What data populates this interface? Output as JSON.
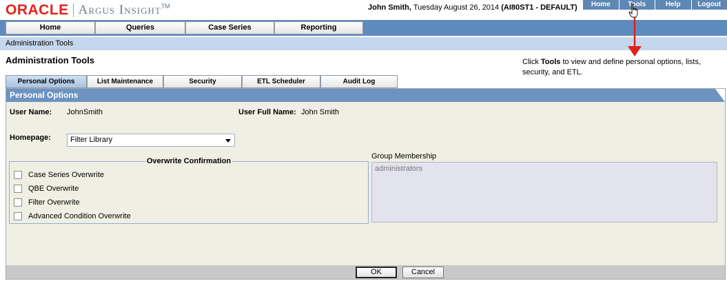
{
  "brand": {
    "oracle": "ORACLE",
    "product": "Argus Insight",
    "tm": "TM"
  },
  "user": {
    "name": "John Smith,",
    "date": "Tuesday August 26, 2014",
    "env": "(AI80ST1 - DEFAULT)"
  },
  "toplinks": [
    "Home",
    "Tools",
    "Help",
    "Logout"
  ],
  "mainnav": [
    "Home",
    "Queries",
    "Case Series",
    "Reporting"
  ],
  "breadcrumb": "Administration Tools",
  "page_title": "Administration Tools",
  "callout": {
    "pre": "Click ",
    "bold": "Tools",
    "post": " to view and define personal options, lists, security, and ETL."
  },
  "tabs": [
    "Personal Options",
    "List Maintenance",
    "Security",
    "ETL Scheduler",
    "Audit Log"
  ],
  "panel": {
    "title": "Personal Options",
    "user_name_label": "User Name:",
    "user_name_value": "JohnSmith",
    "full_name_label": "User Full Name:",
    "full_name_value": "John Smith",
    "homepage_label": "Homepage:",
    "homepage_value": "Filter Library",
    "overwrite_legend": "Overwrite Confirmation",
    "overwrite_options": [
      "Case Series Overwrite",
      "QBE Overwrite",
      "Filter Overwrite",
      "Advanced Condition Overwrite"
    ],
    "group_label": "Group Membership",
    "group_value": "administrators",
    "ok_label": "OK",
    "cancel_label": "Cancel"
  },
  "colors": {
    "nav_blue": "#5e8bbd",
    "panel_head": "#6d93c0",
    "oracle_red": "#e2231a",
    "arrow_red": "#e0201c"
  },
  "icons": {
    "cursor": "hand-pointer-icon",
    "arrow": "arrow-down-icon",
    "select": "chevron-down-icon"
  }
}
